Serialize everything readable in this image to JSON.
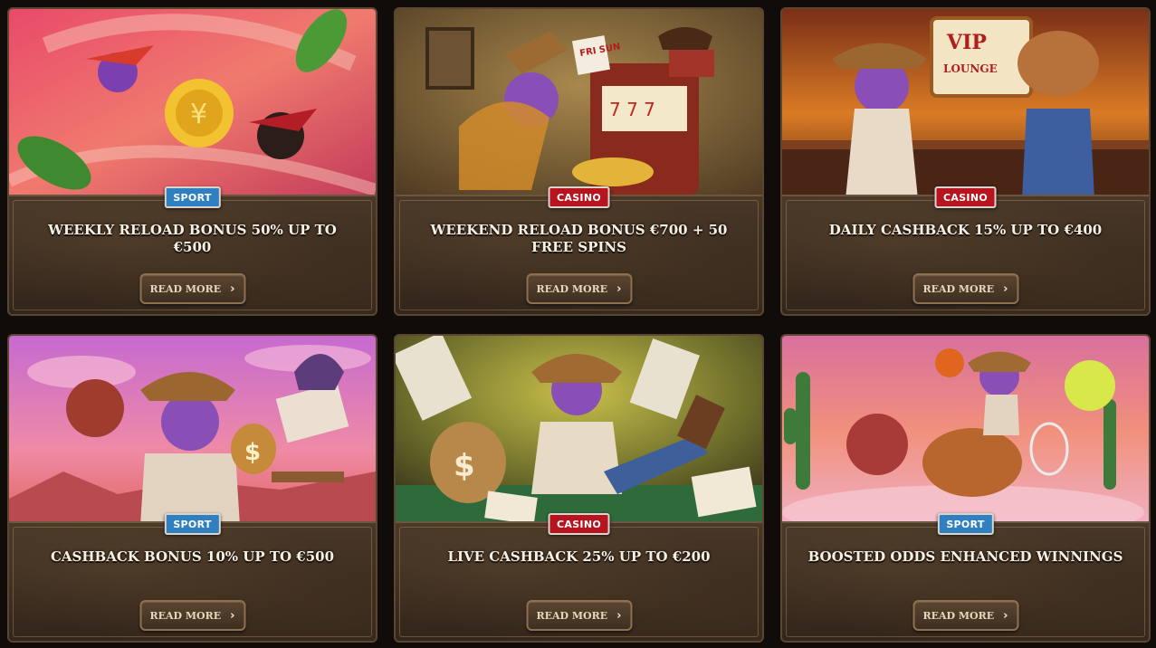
{
  "promotions": [
    {
      "category": "SPORT",
      "badge_color": "#2f7fc1",
      "title": "WEEKLY RELOAD BONUS 50% UP TO €500",
      "button": "READ MORE"
    },
    {
      "category": "CASINO",
      "badge_color": "#b8141f",
      "title": "WEEKEND RELOAD BONUS €700 + 50 FREE SPINS",
      "button": "READ MORE",
      "art_sign": "FRI SUN"
    },
    {
      "category": "CASINO",
      "badge_color": "#b8141f",
      "title": "DAILY CASHBACK 15% UP TO €400",
      "button": "READ MORE",
      "art_sign": "VIP LOUNGE"
    },
    {
      "category": "SPORT",
      "badge_color": "#2f7fc1",
      "title": "CASHBACK BONUS 10% UP TO €500",
      "button": "READ MORE"
    },
    {
      "category": "CASINO",
      "badge_color": "#b8141f",
      "title": "LIVE CASHBACK 25% UP TO €200",
      "button": "READ MORE"
    },
    {
      "category": "SPORT",
      "badge_color": "#2f7fc1",
      "title": "BOOSTED ODDS ENHANCED WINNINGS",
      "button": "READ MORE"
    }
  ],
  "colors": {
    "page_bg": "#0f0c09",
    "panel": "#3a2c1f",
    "border": "#5b4632",
    "title_text": "#f6efe3"
  },
  "icons": {
    "button_icon": "chevron-right-icon"
  }
}
